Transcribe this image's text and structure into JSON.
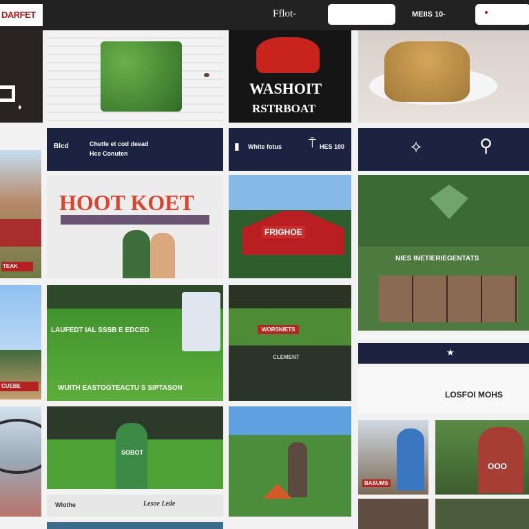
{
  "header": {
    "logo": "DARFET",
    "find_label": "Fflot-",
    "meta_label": "MEIIS 10-"
  },
  "col_a": {
    "banner1": "WASHOIT",
    "banner2": "RSTRBOAT"
  },
  "strips": {
    "left_title": "Blcd",
    "left_l1": "Chetfe et cod deead",
    "left_l2": "Hce Conuten",
    "mid_title": "White fotus",
    "mid_val": "HES 100"
  },
  "poster": {
    "title": "HOOT KOET"
  },
  "barn": {
    "sign": "FRIGHOE"
  },
  "side": {
    "caption": "NIES INETIERIEGENTATS"
  },
  "field_a": {
    "line1": "LAUFEDT IAL SSSB E EDCED",
    "line2": "WUITH EASTOGTEACTU S SIPTASON"
  },
  "field_b": {
    "sign": "WORSNIETS"
  },
  "left_thumb_banner": "TEAK",
  "lower_left_banner": "CUEBE",
  "caption_left": "Wlothe",
  "caption_right": "Lesoe Lede",
  "promo": {
    "title": "LOSFOI MOHS"
  },
  "jersey": "SOBOT",
  "hat": "OOO",
  "small_banner": "BASUMS",
  "forest_label": "CLEMENT"
}
